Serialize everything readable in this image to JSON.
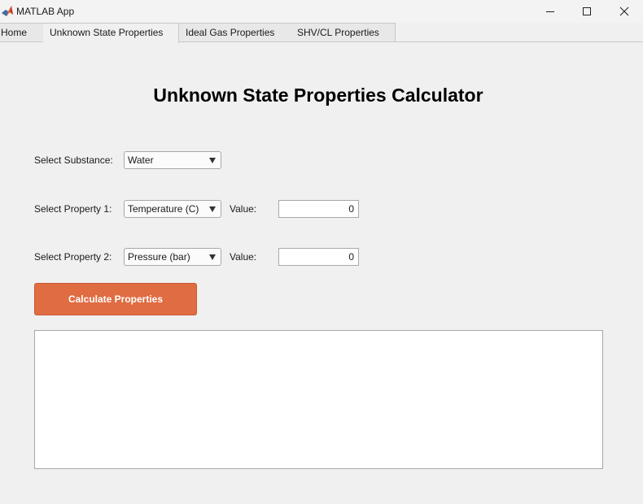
{
  "window": {
    "title": "MATLAB App",
    "controls": [
      "minimize-icon",
      "maximize-icon",
      "close-icon"
    ]
  },
  "tabs": [
    {
      "label": "Home",
      "active": false
    },
    {
      "label": "Unknown State Properties",
      "active": true
    },
    {
      "label": "Ideal Gas Properties",
      "active": false
    },
    {
      "label": "SHV/CL Properties",
      "active": false
    }
  ],
  "main": {
    "heading": "Unknown State Properties Calculator",
    "substance": {
      "label": "Select Substance:",
      "selected": "Water"
    },
    "property1": {
      "label": "Select Property 1:",
      "selected": "Temperature (C)",
      "value_label": "Value:",
      "value": "0"
    },
    "property2": {
      "label": "Select Property 2:",
      "selected": "Pressure (bar)",
      "value_label": "Value:",
      "value": "0"
    },
    "calculate_label": "Calculate Properties",
    "output_text": ""
  },
  "colors": {
    "accent_button": "#e06c42",
    "background": "#f0f0f0"
  }
}
